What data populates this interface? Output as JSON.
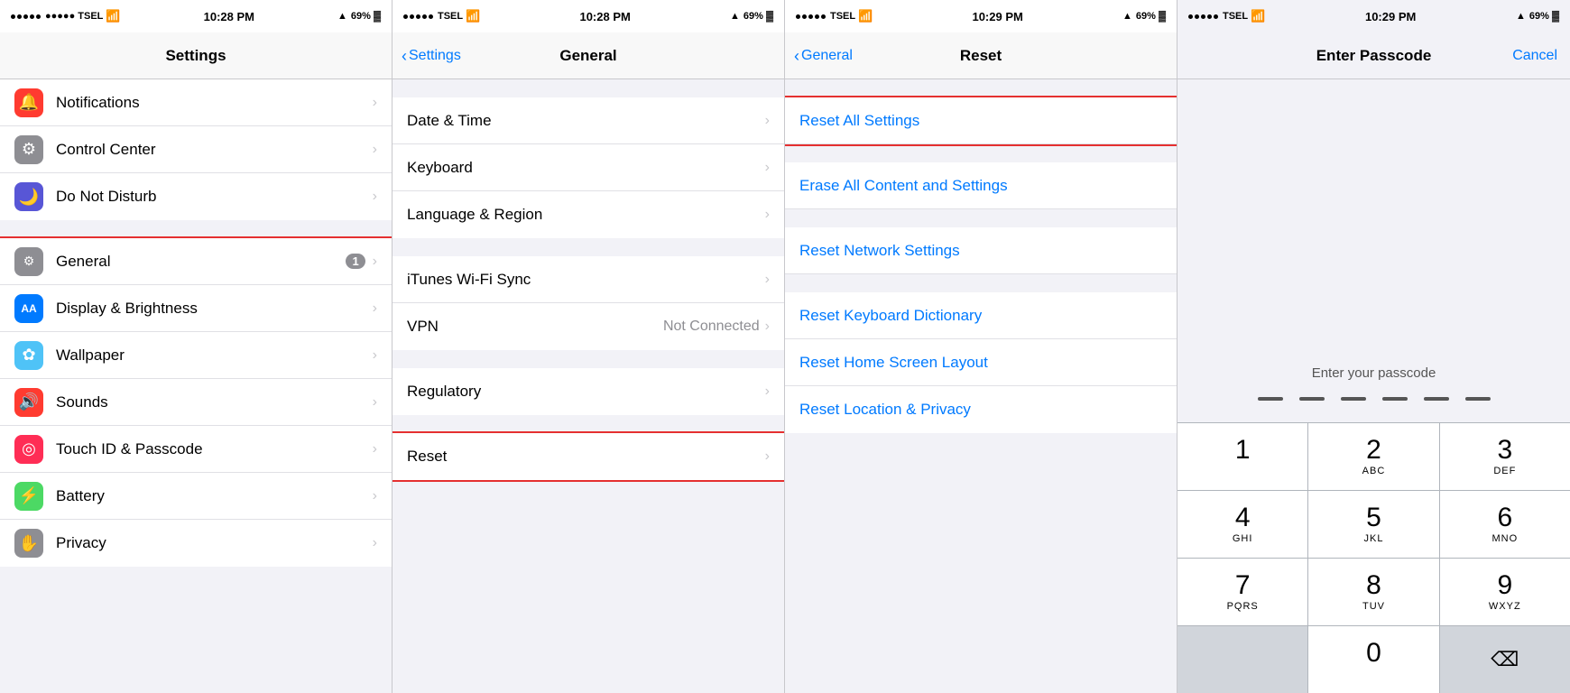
{
  "panels": [
    {
      "id": "settings",
      "statusBar": {
        "carrier": "●●●●● TSEL",
        "wifi": "wifi",
        "time": "10:28 PM",
        "location": "▲",
        "battery": "69% ▓"
      },
      "navTitle": "Settings",
      "items": [
        {
          "icon": "🔔",
          "iconBg": "#ff3b30",
          "label": "Notifications",
          "highlighted": false
        },
        {
          "icon": "⚙",
          "iconBg": "#8e8e93",
          "label": "Control Center",
          "highlighted": false
        },
        {
          "icon": "🌙",
          "iconBg": "#5856d6",
          "label": "Do Not Disturb",
          "highlighted": false
        },
        {
          "icon": "⚙",
          "iconBg": "#8e8e93",
          "label": "General",
          "badge": "1",
          "highlighted": true
        },
        {
          "icon": "AA",
          "iconBg": "#007aff",
          "label": "Display & Brightness",
          "highlighted": false
        },
        {
          "icon": "✿",
          "iconBg": "#007aff",
          "label": "Wallpaper",
          "highlighted": false
        },
        {
          "icon": "🔊",
          "iconBg": "#ff3b30",
          "label": "Sounds",
          "highlighted": false
        },
        {
          "icon": "◎",
          "iconBg": "#ff2d55",
          "label": "Touch ID & Passcode",
          "highlighted": false
        },
        {
          "icon": "▶",
          "iconBg": "#4cd964",
          "label": "Battery",
          "highlighted": false
        },
        {
          "icon": "✋",
          "iconBg": "#8e8e93",
          "label": "Privacy",
          "highlighted": false
        }
      ]
    },
    {
      "id": "general",
      "statusBar": {
        "carrier": "●●●●● TSEL",
        "wifi": "wifi",
        "time": "10:28 PM",
        "location": "▲",
        "battery": "69% ▓"
      },
      "navBack": "Settings",
      "navTitle": "General",
      "groups": [
        {
          "items": [
            {
              "label": "Date & Time",
              "value": ""
            },
            {
              "label": "Keyboard",
              "value": ""
            },
            {
              "label": "Language & Region",
              "value": ""
            }
          ]
        },
        {
          "items": [
            {
              "label": "iTunes Wi-Fi Sync",
              "value": ""
            },
            {
              "label": "VPN",
              "value": "Not Connected"
            }
          ]
        },
        {
          "items": [
            {
              "label": "Regulatory",
              "value": ""
            }
          ]
        },
        {
          "items": [
            {
              "label": "Reset",
              "value": "",
              "highlighted": true
            }
          ]
        }
      ]
    },
    {
      "id": "reset",
      "statusBar": {
        "carrier": "●●●●● TSEL",
        "wifi": "wifi",
        "time": "10:29 PM",
        "location": "▲",
        "battery": "69% ▓"
      },
      "navBack": "General",
      "navTitle": "Reset",
      "items": [
        {
          "label": "Reset All Settings",
          "highlighted": true
        },
        {
          "label": "Erase All Content and Settings",
          "highlighted": false
        },
        {
          "label": "Reset Network Settings",
          "highlighted": false
        },
        {
          "label": "Reset Keyboard Dictionary",
          "highlighted": false
        },
        {
          "label": "Reset Home Screen Layout",
          "highlighted": false
        },
        {
          "label": "Reset Location & Privacy",
          "highlighted": false
        }
      ]
    },
    {
      "id": "passcode",
      "statusBar": {
        "carrier": "●●●●● TSEL",
        "wifi": "wifi",
        "time": "10:29 PM",
        "location": "▲",
        "battery": "69% ▓"
      },
      "navTitle": "Enter Passcode",
      "navCancel": "Cancel",
      "prompt": "Enter your passcode",
      "numpad": [
        [
          {
            "number": "1",
            "letters": ""
          },
          {
            "number": "2",
            "letters": "ABC"
          },
          {
            "number": "3",
            "letters": "DEF"
          }
        ],
        [
          {
            "number": "4",
            "letters": "GHI"
          },
          {
            "number": "5",
            "letters": "JKL"
          },
          {
            "number": "6",
            "letters": "MNO"
          }
        ],
        [
          {
            "number": "7",
            "letters": "PQRS"
          },
          {
            "number": "8",
            "letters": "TUV"
          },
          {
            "number": "9",
            "letters": "WXYZ"
          }
        ],
        [
          {
            "number": "",
            "letters": "",
            "type": "empty"
          },
          {
            "number": "0",
            "letters": ""
          },
          {
            "number": "⌫",
            "letters": "",
            "type": "delete"
          }
        ]
      ]
    }
  ]
}
